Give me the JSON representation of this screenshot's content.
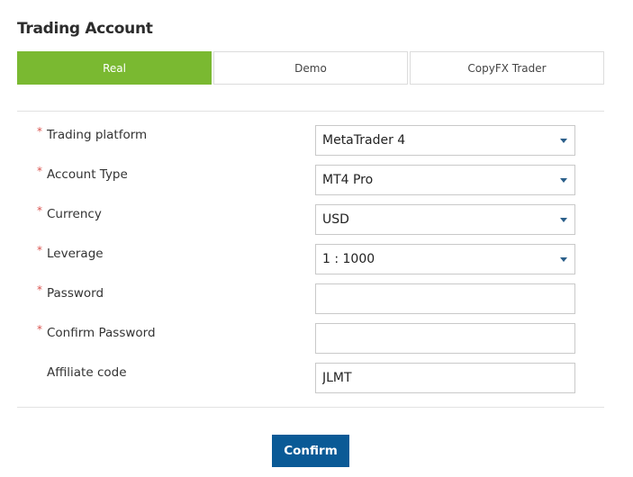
{
  "title": "Trading Account",
  "tabs": [
    {
      "label": "Real",
      "active": true
    },
    {
      "label": "Demo",
      "active": false
    },
    {
      "label": "CopyFX Trader",
      "active": false
    }
  ],
  "form": {
    "required_marker": "*",
    "platform": {
      "label": "Trading platform",
      "value": "MetaTrader 4",
      "required": true
    },
    "account_type": {
      "label": "Account Type",
      "value": "MT4 Pro",
      "required": true
    },
    "currency": {
      "label": "Currency",
      "value": "USD",
      "required": true
    },
    "leverage": {
      "label": "Leverage",
      "value": "1 : 1000",
      "required": true
    },
    "password": {
      "label": "Password",
      "value": "",
      "required": true
    },
    "confirm_password": {
      "label": "Confirm Password",
      "value": "",
      "required": true
    },
    "affiliate_code": {
      "label": "Affiliate code",
      "value": "JLMT",
      "required": false
    }
  },
  "confirm_label": "Confirm",
  "colors": {
    "accent": "#7ab931",
    "primary_button": "#0a5a96",
    "required": "#d9534f"
  },
  "icons": {
    "dropdown": "chevron-down-icon"
  }
}
